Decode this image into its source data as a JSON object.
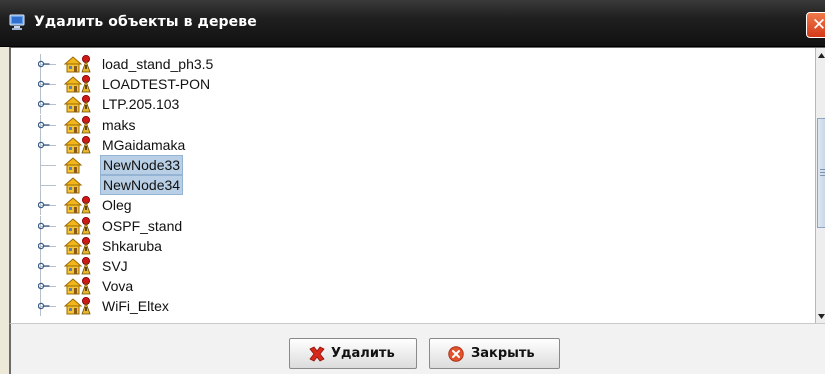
{
  "window": {
    "title": "Удалить объекты в дереве",
    "close_glyph": "✕"
  },
  "tree": {
    "items": [
      {
        "label": "load_stand_ph3.5",
        "expandable": true,
        "alarm": true,
        "selected": false
      },
      {
        "label": "LOADTEST-PON",
        "expandable": true,
        "alarm": true,
        "selected": false
      },
      {
        "label": "LTP.205.103",
        "expandable": true,
        "alarm": true,
        "selected": false
      },
      {
        "label": "maks",
        "expandable": true,
        "alarm": true,
        "selected": false
      },
      {
        "label": "MGaidamaka",
        "expandable": true,
        "alarm": true,
        "selected": false
      },
      {
        "label": "NewNode33",
        "expandable": false,
        "alarm": false,
        "selected": true
      },
      {
        "label": "NewNode34",
        "expandable": false,
        "alarm": false,
        "selected": true
      },
      {
        "label": "Oleg",
        "expandable": true,
        "alarm": true,
        "selected": false
      },
      {
        "label": "OSPF_stand",
        "expandable": true,
        "alarm": true,
        "selected": false
      },
      {
        "label": "Shkaruba",
        "expandable": true,
        "alarm": true,
        "selected": false
      },
      {
        "label": "SVJ",
        "expandable": true,
        "alarm": true,
        "selected": false
      },
      {
        "label": "Vova",
        "expandable": true,
        "alarm": true,
        "selected": false
      },
      {
        "label": "WiFi_Eltex",
        "expandable": true,
        "alarm": true,
        "selected": false
      }
    ]
  },
  "buttons": {
    "delete_label": "Удалить",
    "delete_icon": "delete-cross-icon",
    "close_label": "Закрыть",
    "close_icon": "close-circle-icon"
  },
  "icons": {
    "node": "house-node-icon",
    "alarm": "alarm-figure-icon"
  },
  "colors": {
    "selection": "#b8cfe5",
    "titlebar": "#1f1f1f",
    "close_button": "#d4391a"
  }
}
